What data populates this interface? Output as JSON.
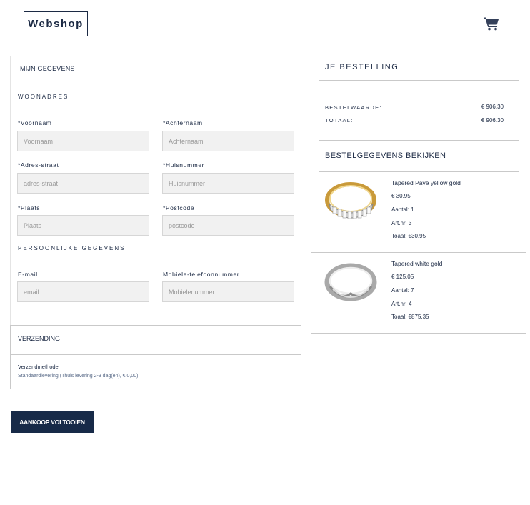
{
  "header": {
    "logo": "Webshop",
    "cart_icon": "shopping-cart-icon"
  },
  "form": {
    "title": "MIJN GEGEVENS",
    "address_section": "WOONADRES",
    "fields": {
      "firstname": {
        "label": "*Voornaam",
        "placeholder": "Voornaam"
      },
      "lastname": {
        "label": "*Achternaam",
        "placeholder": "Achternaam"
      },
      "street": {
        "label": "*Adres-straat",
        "placeholder": "adres-straat"
      },
      "housenumber": {
        "label": "*Huisnummer",
        "placeholder": "Huisnummer"
      },
      "city": {
        "label": "*Plaats",
        "placeholder": "Plaats"
      },
      "postcode": {
        "label": "*Postcode",
        "placeholder": "postcode"
      },
      "email": {
        "label": "E-mail",
        "placeholder": "email"
      },
      "mobile": {
        "label": "Mobiele-telefoonnummer",
        "placeholder": "Mobielenummer"
      }
    },
    "personal_section": "PERSOONLIJKE GEGEVENS"
  },
  "shipping": {
    "title": "VERZENDING",
    "method_label": "Verzendmethode",
    "method_value": "Standaardlevering (Thuis levering 2-3 dag(en), € 0,00)"
  },
  "complete_button": "AANKOOP VOLTOOIEN",
  "order": {
    "title": "JE BESTELLING",
    "order_value_label": "BESTELWAARDE:",
    "order_value": "€ 906.30",
    "total_label": "TOTAAL:",
    "total": "€ 906.30",
    "details_title": "BESTELGEGEVENS BEKIJKEN",
    "products": [
      {
        "name": "Tapered Pavé yellow gold",
        "price": "€ 30.95",
        "quantity": "Aantal: 1",
        "article": "Art.nr: 3",
        "total": "Toaal: €30.95",
        "color": "#d4a94a"
      },
      {
        "name": "Tapered white gold",
        "price": "€ 125.05",
        "quantity": "Aantal: 7",
        "article": "Art.nr: 4",
        "total": "Toaal: €875.35",
        "color": "#c8c8c8"
      }
    ]
  }
}
